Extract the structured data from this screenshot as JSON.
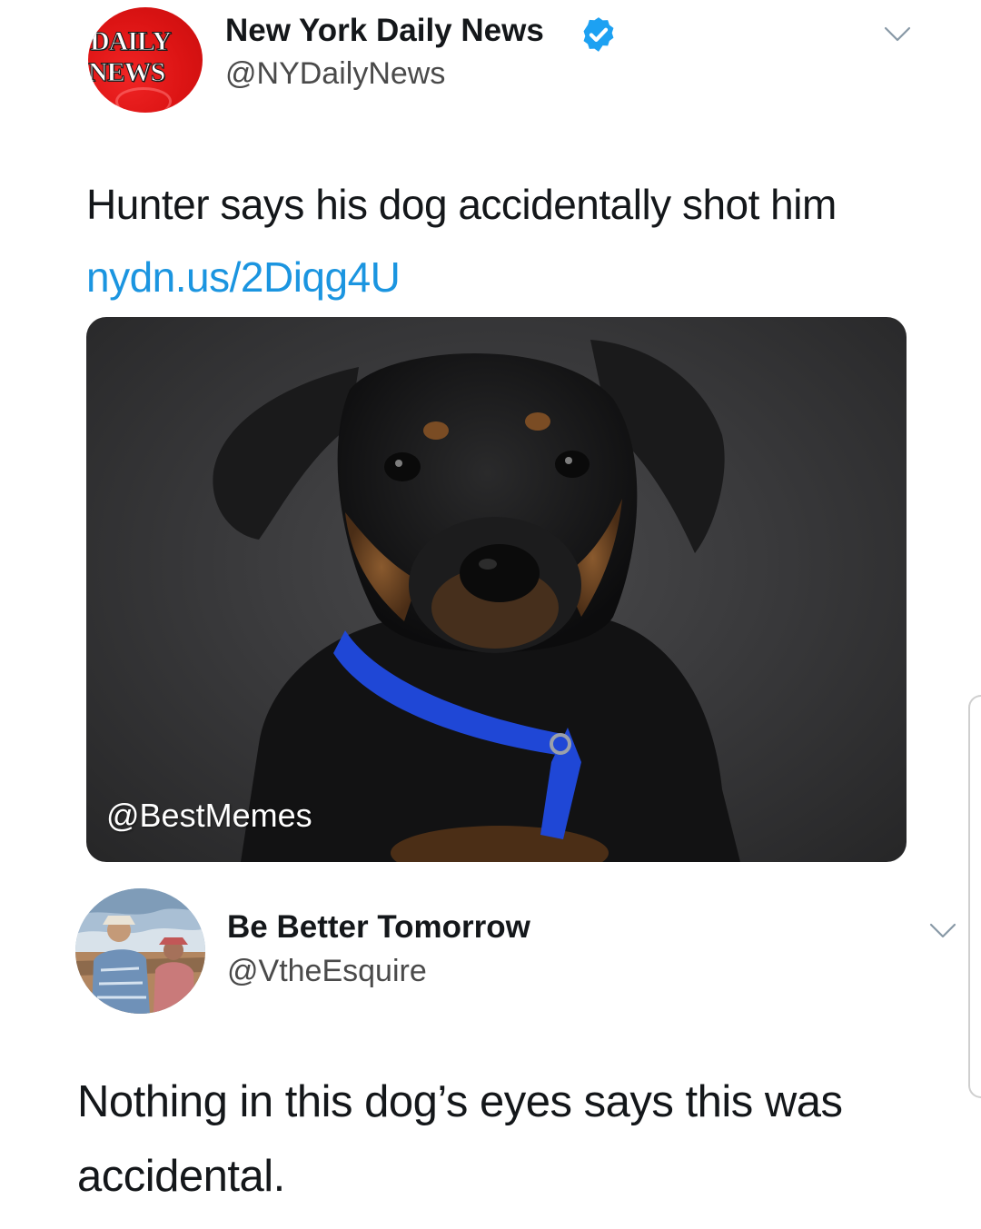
{
  "tweet1": {
    "avatar": {
      "logo_line1": "DAILY",
      "logo_line2": "NEWS",
      "color": "#dc1414"
    },
    "display_name": "New York Daily News",
    "verified": true,
    "verified_color": "#1da1f2",
    "handle": "@NYDailyNews",
    "text": "Hunter says his dog accidentally shot him ",
    "link": "nydn.us/2Diqg4U",
    "link_color": "#1b95e0",
    "menu_icon": "chevron-down-icon",
    "media": {
      "watermark": "@BestMemes"
    }
  },
  "tweet2": {
    "display_name": "Be Better Tomorrow",
    "handle": "@VtheEsquire",
    "text": "Nothing in this dog’s eyes says this was accidental.",
    "menu_icon": "chevron-down-icon"
  }
}
